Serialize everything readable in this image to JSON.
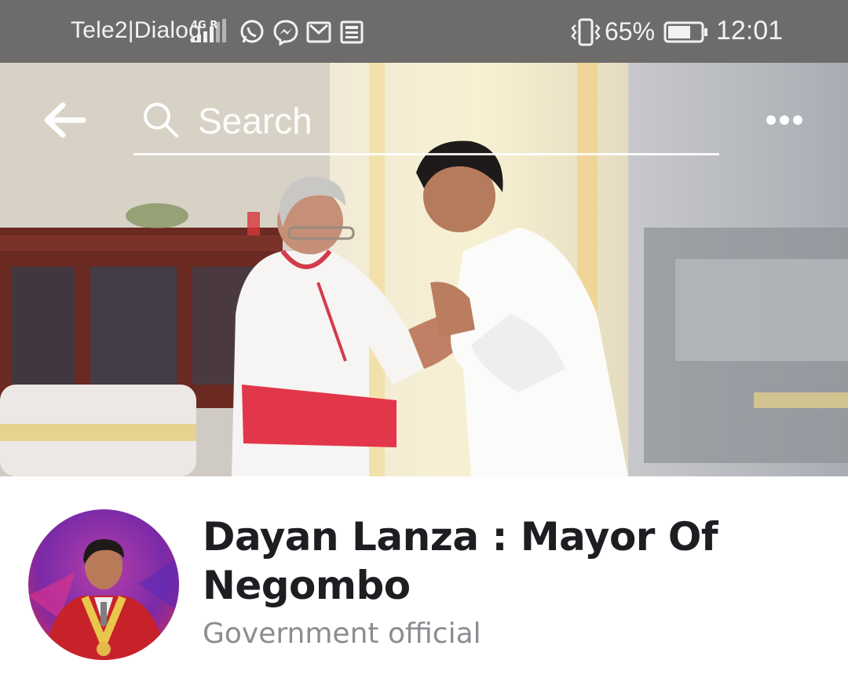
{
  "status_bar": {
    "carrier": "Tele2|Dialog",
    "network_label": "4G R",
    "apps": [
      "whatsapp-icon",
      "messenger-icon",
      "gmail-icon",
      "news-icon"
    ],
    "battery_percent": "65%",
    "time": "12:01"
  },
  "toolbar": {
    "search_placeholder": "Search",
    "back_icon": "back-arrow-icon",
    "more_icon": "more-dots-icon"
  },
  "profile": {
    "name": "Dayan Lanza : Mayor Of Negombo",
    "category": "Government official"
  },
  "colors": {
    "name_text": "#1c1e21",
    "category_text": "#8a8d91",
    "status_bar_bg": "#505050"
  }
}
